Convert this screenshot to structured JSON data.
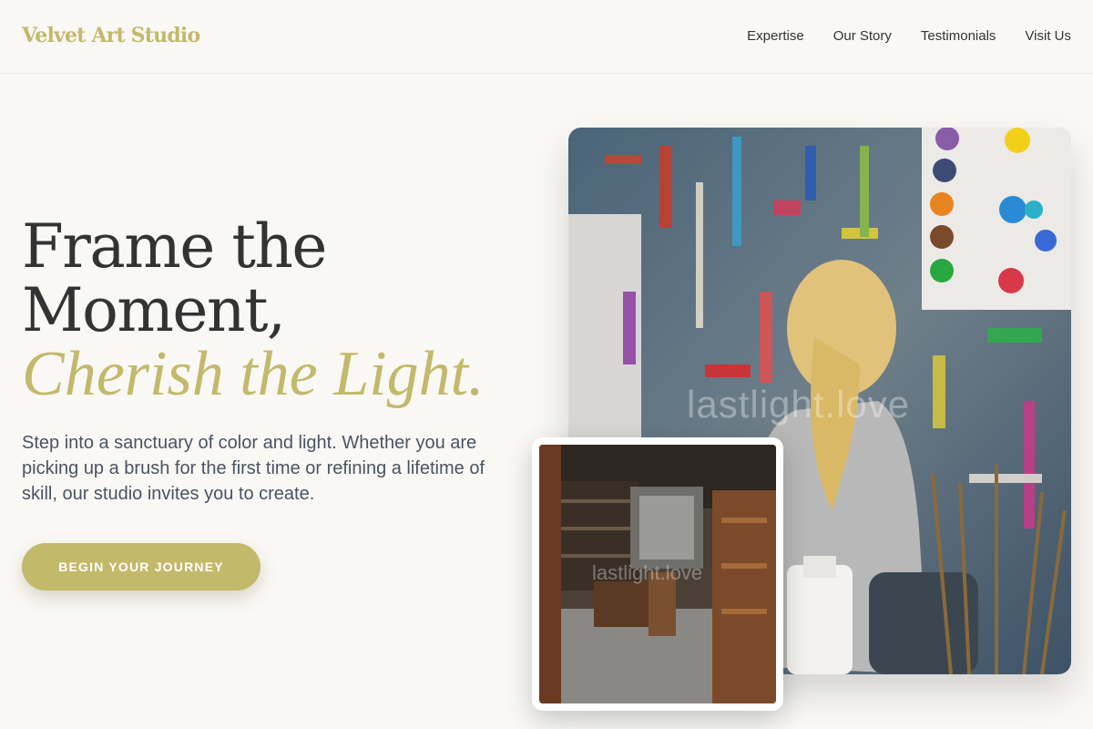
{
  "brand": {
    "name": "Velvet Art Studio",
    "accent_color": "#c2b96b"
  },
  "nav": {
    "items": [
      {
        "label": "Expertise"
      },
      {
        "label": "Our Story"
      },
      {
        "label": "Testimonials"
      },
      {
        "label": "Visit Us"
      }
    ]
  },
  "hero": {
    "headline_line1": "Frame the",
    "headline_line2": "Moment,",
    "headline_accent": "Cherish the Light.",
    "subtext": "Step into a sanctuary of color and light. Whether you are picking up a brush for the first time or refining a lifetime of skill, our studio invites you to create.",
    "cta_label": "BEGIN YOUR JOURNEY"
  },
  "images": {
    "main": {
      "watermark": "lastlight.love"
    },
    "inset": {
      "watermark": "lastlight.love"
    }
  }
}
